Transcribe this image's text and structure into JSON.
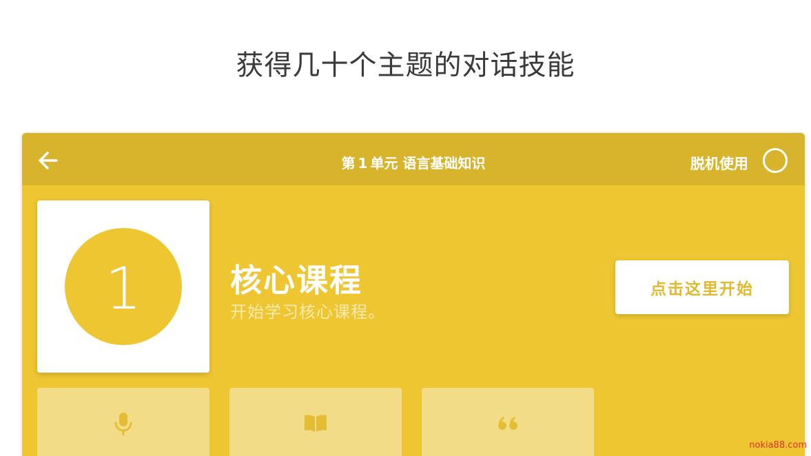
{
  "headline": "获得几十个主题的对话技能",
  "toolbar": {
    "title_prefix": "第",
    "title_number": "1",
    "title_suffix": "单元 语言基础知识",
    "offline_label": "脱机使用",
    "back_icon": "arrow-left-icon",
    "offline_toggle_state": "off"
  },
  "lesson": {
    "number": "1",
    "title": "核心课程",
    "subtitle": "开始学习核心课程。",
    "start_button": "点击这里开始"
  },
  "skills": [
    {
      "icon": "microphone-icon"
    },
    {
      "icon": "book-icon"
    },
    {
      "icon": "quote-icon"
    }
  ],
  "colors": {
    "accent": "#eec632",
    "toolbar": "#d8b42d",
    "tile": "#f3dc88",
    "icon": "#e5bd35"
  },
  "watermark": "nokia88.com"
}
